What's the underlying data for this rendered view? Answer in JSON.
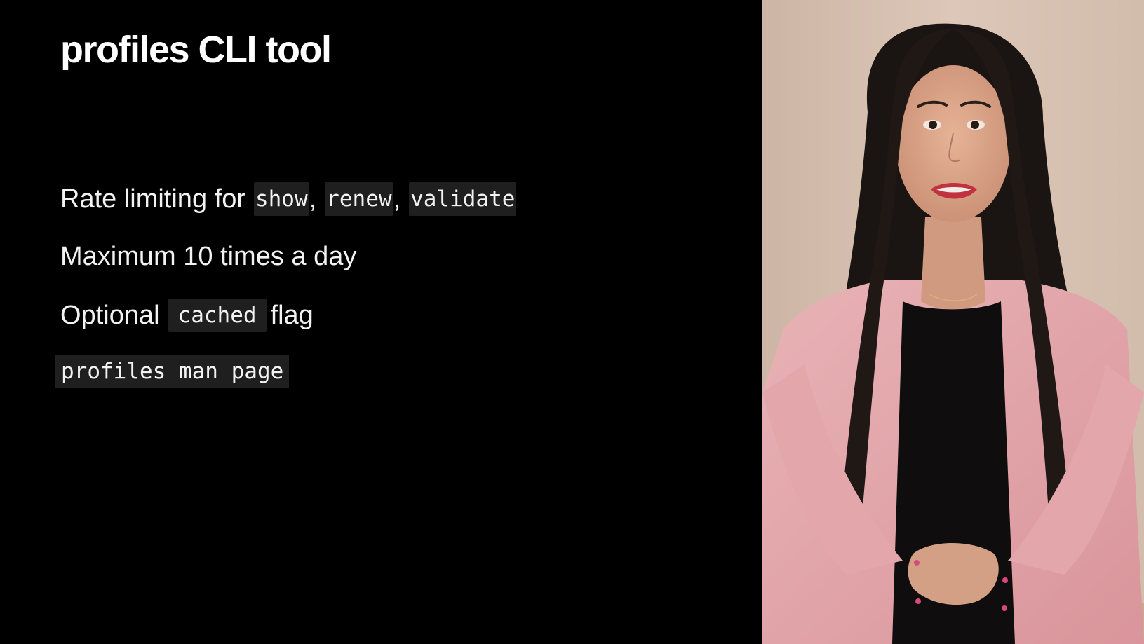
{
  "slide": {
    "title": "profiles CLI tool",
    "bullet1": {
      "text": "Rate limiting for",
      "code1": "show",
      "sep1": ",",
      "code2": "renew",
      "sep2": ",",
      "code3": "validate"
    },
    "bullet2": {
      "text": "Maximum 10 times a day"
    },
    "bullet3": {
      "before": "Optional",
      "code": "cached",
      "after": "flag"
    },
    "man_page_code": "profiles man page"
  },
  "video": {
    "description_icon": "presenter-video",
    "colors": {
      "wall": "#d9c3b3",
      "cardigan": "#e4a9ad",
      "hair": "#1a1412",
      "skin": "#d9a68a",
      "shirt": "#0f0d0d",
      "lips": "#c0323d"
    }
  }
}
